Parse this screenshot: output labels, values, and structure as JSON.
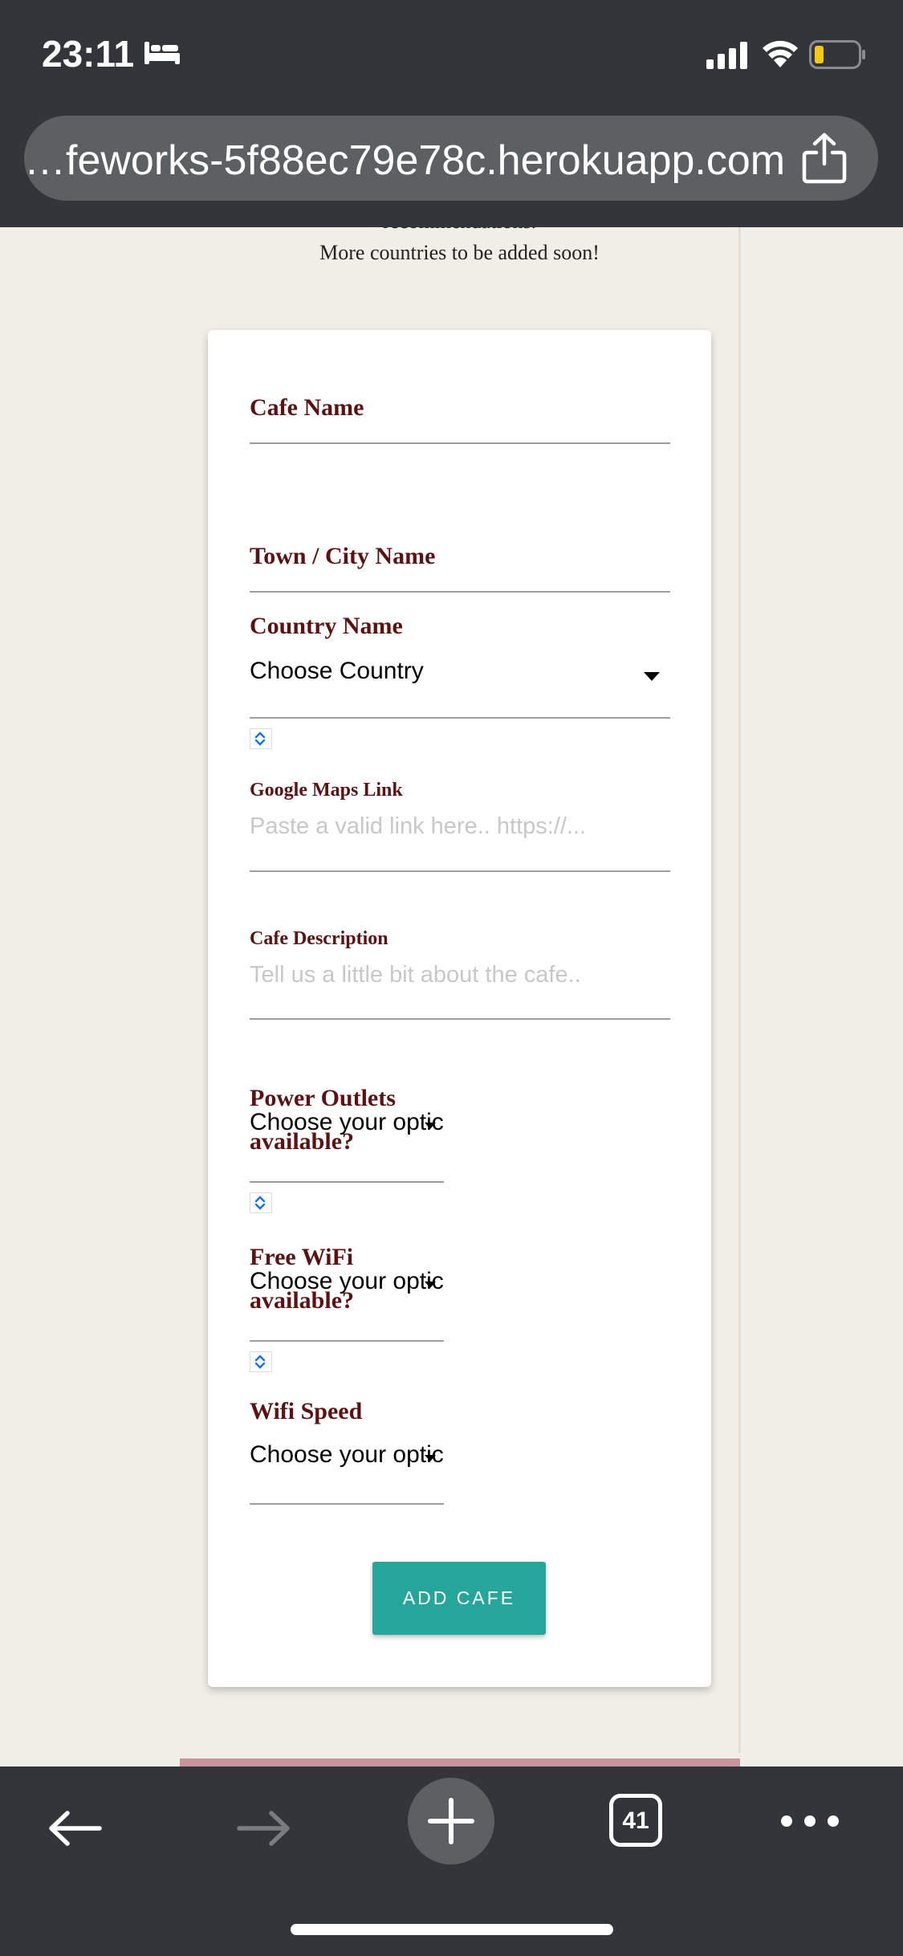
{
  "status_bar": {
    "time": "23:11",
    "icons": [
      "bed-icon",
      "signal-icon",
      "wifi-icon",
      "battery-icon"
    ],
    "battery_color": "#f5c816"
  },
  "browser": {
    "url": "…feworks-5f88ec79e78c.herokuapp.com",
    "share_icon": "share-icon"
  },
  "page": {
    "cut_off_text": "recommendations.",
    "intro_text": "More countries to be added soon!",
    "form": {
      "cafe_name_label": "Cafe Name",
      "town_label": "Town / City Name",
      "country_label": "Country Name",
      "country_value": "Choose Country",
      "maps_label": "Google Maps Link",
      "maps_placeholder": "Paste a valid link here.. https://...",
      "description_label": "Cafe Description",
      "description_placeholder": "Tell us a little bit about the cafe..",
      "power_label": "Power Outlets available?",
      "power_value": "Choose your optic",
      "wifi_label": "Free WiFi available?",
      "wifi_value": "Choose your optic",
      "speed_label": "Wifi Speed",
      "speed_value": "Choose your optic",
      "submit_label": "ADD CAFE"
    },
    "colors": {
      "label": "#5a1212",
      "button": "#26a69a",
      "background": "#f1eee7",
      "footer_strip": "#c9959a"
    }
  },
  "toolbar": {
    "tab_count": "41",
    "icons": [
      "back-arrow-icon",
      "forward-arrow-icon",
      "plus-icon",
      "tabs-icon",
      "more-icon"
    ]
  }
}
